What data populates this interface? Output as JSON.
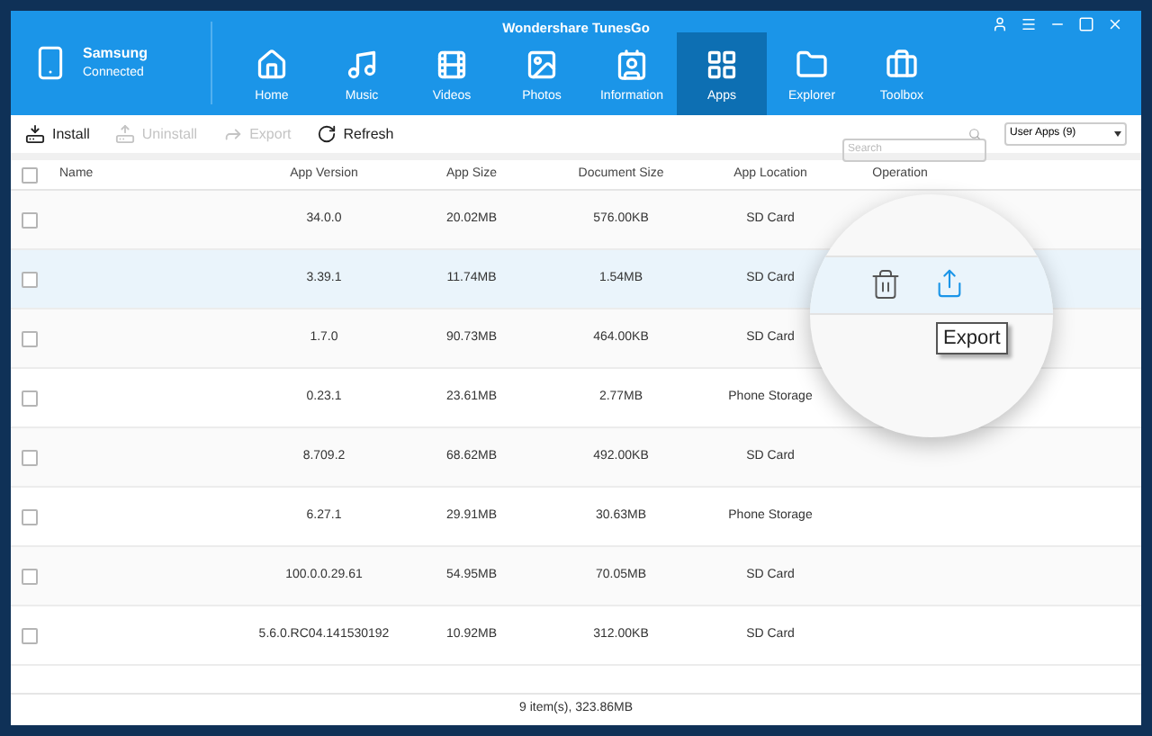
{
  "window": {
    "title": "Wondershare TunesGo"
  },
  "device": {
    "name": "Samsung",
    "status": "Connected"
  },
  "nav": [
    {
      "label": "Home",
      "selected": false
    },
    {
      "label": "Music",
      "selected": false
    },
    {
      "label": "Videos",
      "selected": false
    },
    {
      "label": "Photos",
      "selected": false
    },
    {
      "label": "Information",
      "selected": false
    },
    {
      "label": "Apps",
      "selected": true
    },
    {
      "label": "Explorer",
      "selected": false
    },
    {
      "label": "Toolbox",
      "selected": false
    }
  ],
  "toolbar": [
    {
      "kind": "install",
      "label": "Install",
      "disabled": false
    },
    {
      "kind": "uninstall",
      "label": "Uninstall",
      "disabled": true
    },
    {
      "kind": "export",
      "label": "Export",
      "disabled": true
    },
    {
      "kind": "refresh",
      "label": "Refresh",
      "disabled": false
    }
  ],
  "search": {
    "placeholder": "Search"
  },
  "filter": {
    "value": "User Apps (9)"
  },
  "table": {
    "select_all": {
      "checked": false
    },
    "columns": [
      "Name",
      "App Version",
      "App Size",
      "Document Size",
      "App Location",
      "Operation"
    ],
    "rows": [
      {
        "checked": false,
        "selected": false,
        "version": "34.0.0",
        "app_size": "20.02MB",
        "doc_size": "576.00KB",
        "location": "SD Card"
      },
      {
        "checked": false,
        "selected": true,
        "version": "3.39.1",
        "app_size": "11.74MB",
        "doc_size": "1.54MB",
        "location": "SD Card"
      },
      {
        "checked": false,
        "selected": false,
        "version": "1.7.0",
        "app_size": "90.73MB",
        "doc_size": "464.00KB",
        "location": "SD Card"
      },
      {
        "checked": false,
        "selected": false,
        "version": "0.23.1",
        "app_size": "23.61MB",
        "doc_size": "2.77MB",
        "location": "Phone Storage"
      },
      {
        "checked": false,
        "selected": false,
        "version": "8.709.2",
        "app_size": "68.62MB",
        "doc_size": "492.00KB",
        "location": "SD Card"
      },
      {
        "checked": false,
        "selected": false,
        "version": "6.27.1",
        "app_size": "29.91MB",
        "doc_size": "30.63MB",
        "location": "Phone Storage"
      },
      {
        "checked": false,
        "selected": false,
        "version": "100.0.0.29.61",
        "app_size": "54.95MB",
        "doc_size": "70.05MB",
        "location": "SD Card"
      },
      {
        "checked": false,
        "selected": false,
        "version": "5.6.0.RC04.141530192",
        "app_size": "10.92MB",
        "doc_size": "312.00KB",
        "location": "SD Card"
      }
    ]
  },
  "magnifier": {
    "tooltip": "Export"
  },
  "status_bar": "9 item(s), 323.86MB"
}
